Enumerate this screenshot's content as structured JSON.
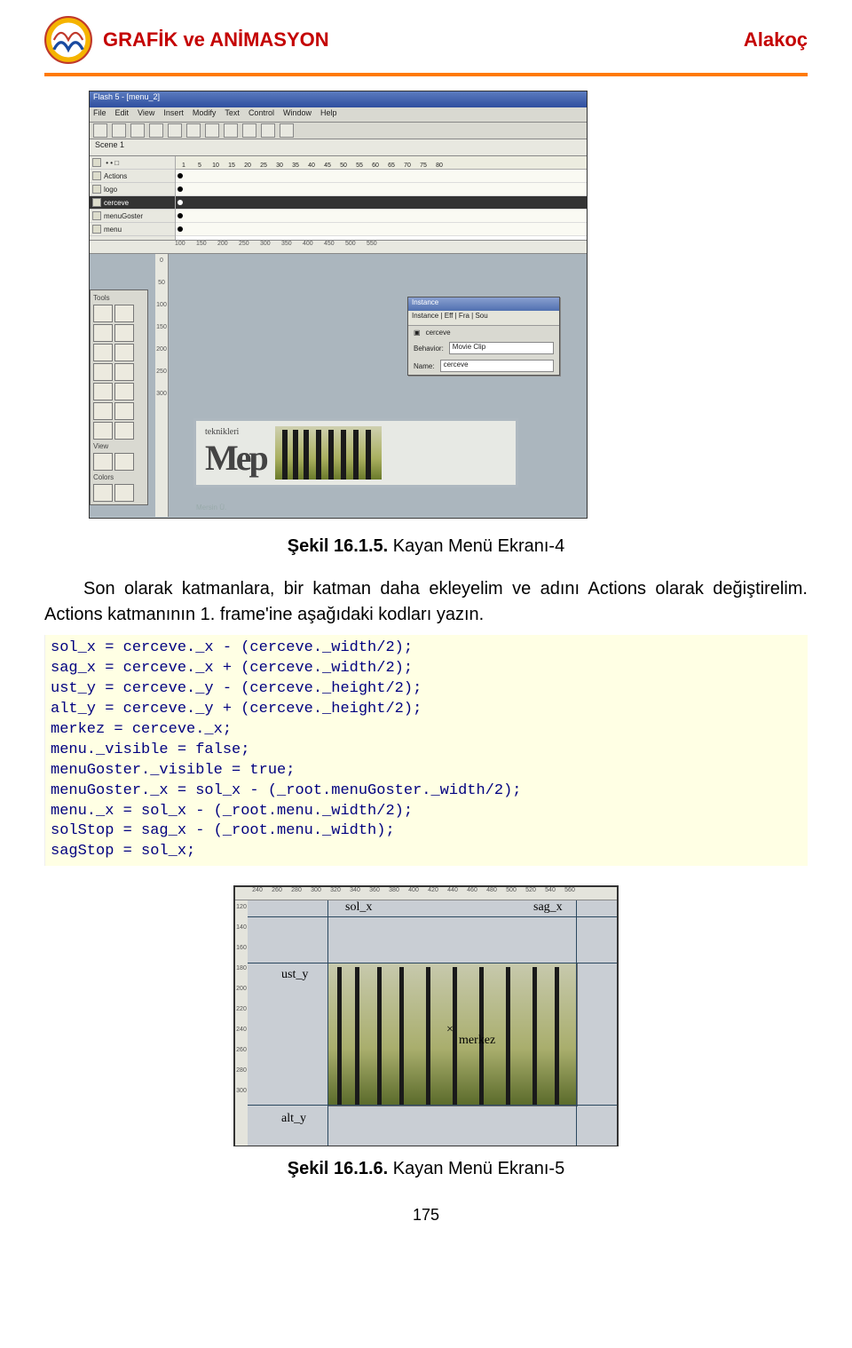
{
  "header": {
    "title": "GRAFİK ve ANİMASYON",
    "author": "Alakoç"
  },
  "flash": {
    "title": "Flash 5 - [menu_2]",
    "menus": [
      "File",
      "Edit",
      "View",
      "Insert",
      "Modify",
      "Text",
      "Control",
      "Window",
      "Help"
    ],
    "scene": "Scene 1",
    "layers": [
      "Actions",
      "logo",
      "cerceve",
      "menuGoster",
      "menu"
    ],
    "frame_numbers": [
      "1",
      "5",
      "10",
      "15",
      "20",
      "25",
      "30",
      "35",
      "40",
      "45",
      "50",
      "55",
      "60",
      "65",
      "70",
      "75",
      "80"
    ],
    "ruler_top": [
      "100",
      "150",
      "200",
      "250",
      "300",
      "350",
      "400",
      "450",
      "500",
      "550"
    ],
    "ruler_side": [
      "0",
      "50",
      "100",
      "150",
      "200",
      "250",
      "300"
    ],
    "tools_header": "Tools",
    "tools_view": "View",
    "tools_colors": "Colors",
    "instance_title": "Instance",
    "instance_tabs": "Instance | Eff | Fra | Sou",
    "instance_movie": "cerceve",
    "behavior_label": "Behavior:",
    "behavior_value": "Movie Clip",
    "name_label": "Name:",
    "name_value": "cerceve",
    "logo_top": "teknikleri",
    "logo_main": "Mep",
    "brand_small": "Mersin Ü."
  },
  "figure1_caption_bold": "Şekil 16.1.5.",
  "figure1_caption_rest": " Kayan Menü Ekranı-4",
  "para1": "Son olarak katmanlara, bir katman daha ekleyelim ve adını Actions olarak değiştirelim. Actions katmanının 1. frame'ine aşağıdaki kodları yazın.",
  "code": "sol_x = cerceve._x - (cerceve._width/2);\nsag_x = cerceve._x + (cerceve._width/2);\nust_y = cerceve._y - (cerceve._height/2);\nalt_y = cerceve._y + (cerceve._height/2);\nmerkez = cerceve._x;\nmenu._visible = false;\nmenuGoster._visible = true;\nmenuGoster._x = sol_x - (_root.menuGoster._width/2);\nmenu._x = sol_x - (_root.menu._width/2);\nsolStop = sag_x - (_root.menu._width);\nsagStop = sol_x;",
  "coord": {
    "hruler": [
      "240",
      "260",
      "280",
      "300",
      "320",
      "340",
      "360",
      "380",
      "400",
      "420",
      "440",
      "460",
      "480",
      "500",
      "520",
      "540",
      "560"
    ],
    "vruler": [
      "120",
      "140",
      "160",
      "180",
      "200",
      "220",
      "240",
      "260",
      "280",
      "300"
    ],
    "sol_x": "sol_x",
    "sag_x": "sag_x",
    "ust_y": "ust_y",
    "alt_y": "alt_y",
    "merkez": "merkez",
    "x_mark": "×"
  },
  "figure2_caption_bold": "Şekil 16.1.6.",
  "figure2_caption_rest": " Kayan Menü Ekranı-5",
  "page_number": "175"
}
